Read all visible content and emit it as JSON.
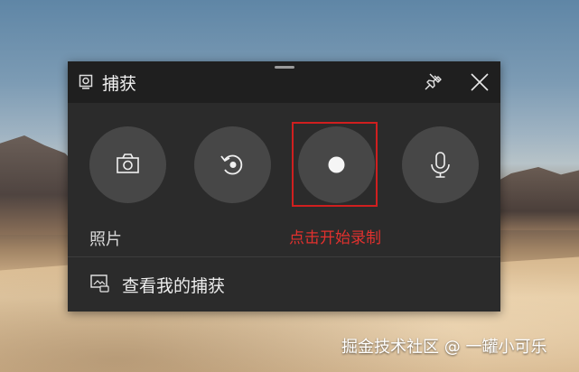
{
  "widget": {
    "title": "捕获",
    "buttons": [
      {
        "name": "screenshot",
        "icon": "camera-icon"
      },
      {
        "name": "record-last",
        "icon": "record-last-icon"
      },
      {
        "name": "start-recording",
        "icon": "record-dot-icon"
      },
      {
        "name": "microphone",
        "icon": "microphone-icon"
      }
    ],
    "photo_label": "照片",
    "record_hint": "点击开始录制",
    "gallery_label": "查看我的捕获"
  },
  "colors": {
    "panel": "#2b2b2b",
    "titlebar": "#1f1f1f",
    "button": "#474747",
    "highlight": "#d01f1f",
    "hint_text": "#e1312e"
  },
  "watermark": "掘金技术社区 @ 一罐小可乐"
}
